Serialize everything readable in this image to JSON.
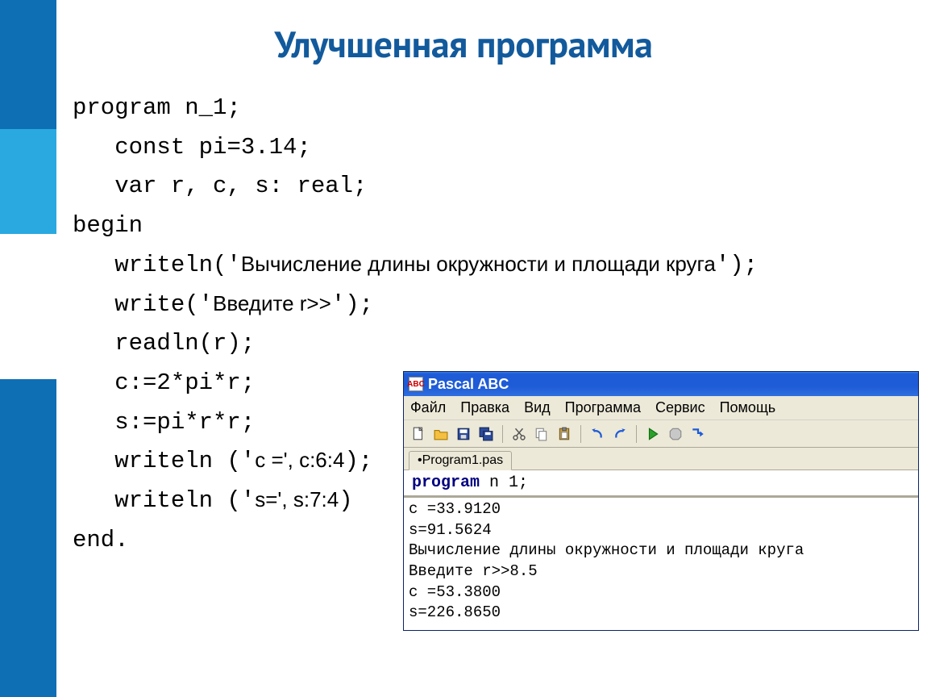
{
  "title": "Улучшенная программа",
  "code": {
    "l1_a": "program",
    "l1_b": " n_1;",
    "l2_a": "   const",
    "l2_b": " pi=3.14;",
    "l3_a": "   var",
    "l3_b": " r, c, s: real;",
    "l4": "begin",
    "l5_a": "   writeln('",
    "l5_mix": "Вычисление длины окружности и площади круга",
    "l5_b": "');",
    "l6_a": "   write('",
    "l6_mix": "Введите r>>",
    "l6_b": "');",
    "l7": "   readln(r);",
    "l8": "   c:=2*pi*r;",
    "l9": "   s:=pi*r*r;",
    "l10_a": "   writeln ('",
    "l10_mix": "c =', c:6:4",
    "l10_b": ");",
    "l11_a": "   writeln ('",
    "l11_mix": "s=', s:7:4",
    "l11_b": ")",
    "l12": "end."
  },
  "ide": {
    "icon_text": "ABC",
    "title": "Pascal ABC",
    "menu": [
      "Файл",
      "Правка",
      "Вид",
      "Программа",
      "Сервис",
      "Помощь"
    ],
    "tab": "Program1.pas",
    "editor_kw": "program",
    "editor_rest": " n 1;",
    "output": "c =33.9120\ns=91.5624\nВычисление длины окружности и площади круга\nВведите r>>8.5\nc =53.3800\ns=226.8650"
  },
  "icons": {
    "new": "new-file-icon",
    "open": "open-folder-icon",
    "save": "save-icon",
    "saveall": "save-all-icon",
    "cut": "scissors-icon",
    "copy": "copy-icon",
    "paste": "paste-icon",
    "undo": "undo-icon",
    "redo": "redo-icon",
    "run": "run-icon",
    "stop": "stop-icon",
    "step": "step-icon"
  }
}
